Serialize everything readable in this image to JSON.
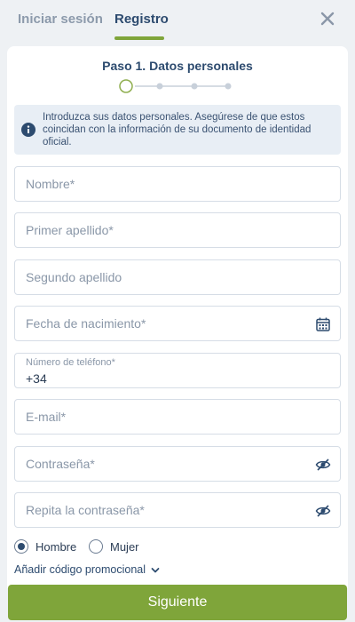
{
  "tabs": {
    "login": "Iniciar sesión",
    "register": "Registro"
  },
  "step": {
    "title": "Paso 1. Datos personales",
    "current": 1,
    "total": 4
  },
  "info": {
    "text": "Introduzca sus datos personales. Asegúrese de que estos coincidan con la información de su documento de identidad oficial."
  },
  "form": {
    "nombre": {
      "placeholder": "Nombre*"
    },
    "apellido1": {
      "placeholder": "Primer apellido*"
    },
    "apellido2": {
      "placeholder": "Segundo apellido"
    },
    "fecha": {
      "placeholder": "Fecha de nacimiento*"
    },
    "telefono": {
      "label": "Número de teléfono*",
      "value": "+34"
    },
    "email": {
      "placeholder": "E-mail*"
    },
    "password": {
      "placeholder": "Contraseña*"
    },
    "password2": {
      "placeholder": "Repita la contraseña*"
    }
  },
  "gender": {
    "male": "Hombre",
    "female": "Mujer",
    "selected": "male"
  },
  "promo": {
    "label": "Añadir código promocional"
  },
  "next": {
    "label": "Siguiente"
  },
  "colors": {
    "accent": "#7fa53a",
    "primary": "#2d4b6f",
    "info_bg": "#e8eef5"
  },
  "icons": {
    "close": "close-icon",
    "info": "info-icon",
    "calendar": "calendar-icon",
    "eye": "eye-slash-icon",
    "chevron": "chevron-down-icon"
  }
}
